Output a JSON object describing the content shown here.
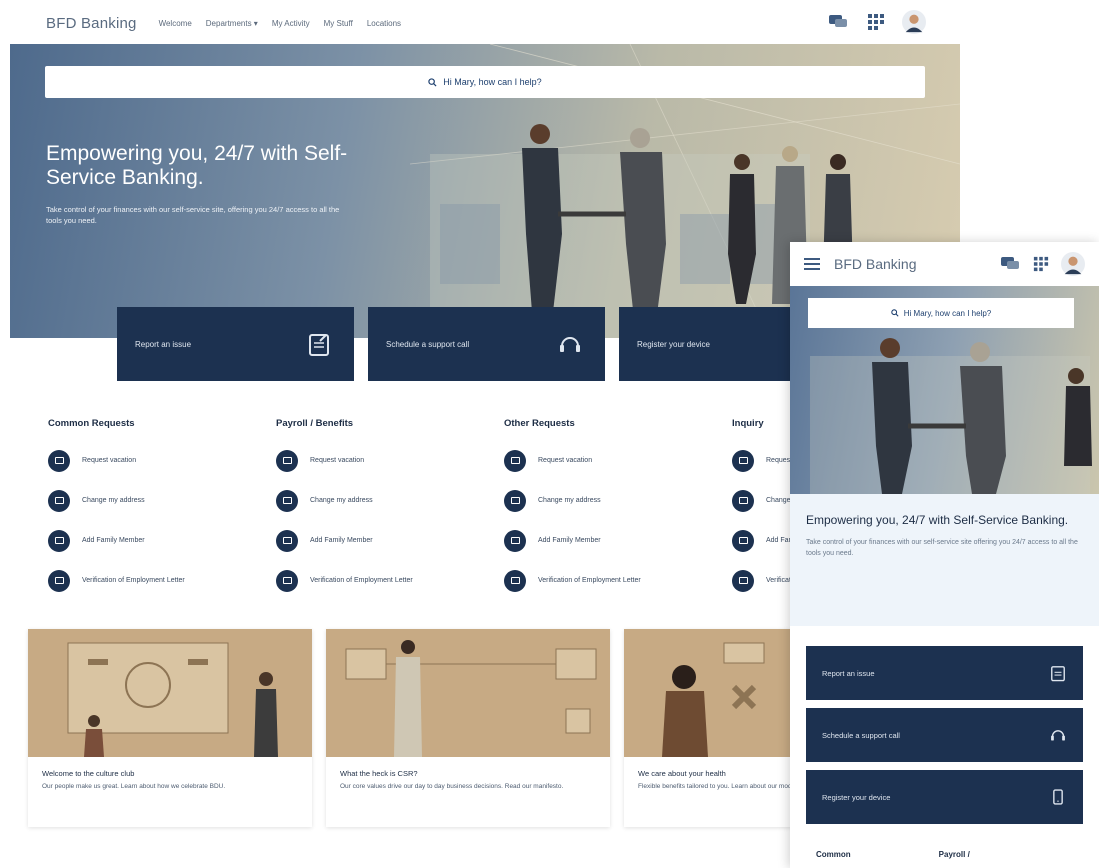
{
  "brand": "BFD Banking",
  "nav": [
    "Welcome",
    "Departments ▾",
    "My Activity",
    "My Stuff",
    "Locations"
  ],
  "search": {
    "placeholder": "Hi Mary, how can I help?"
  },
  "hero": {
    "title": "Empowering you, 24/7 with Self-Service Banking.",
    "subtitle": "Take control of your finances with our self-service site, offering you 24/7 access to all the tools you need."
  },
  "actions": [
    {
      "label": "Report an issue",
      "icon": "clipboard-icon"
    },
    {
      "label": "Schedule a support call",
      "icon": "headset-icon"
    },
    {
      "label": "Register your device",
      "icon": "phone-icon"
    }
  ],
  "request_columns": [
    {
      "title": "Common Requests",
      "items": [
        "Request vacation",
        "Change my address",
        "Add Family Member",
        "Verification of Employment Letter"
      ]
    },
    {
      "title": "Payroll / Benefits",
      "items": [
        "Request vacation",
        "Change my address",
        "Add Family Member",
        "Verification of Employment Letter"
      ]
    },
    {
      "title": "Other Requests",
      "items": [
        "Request vacation",
        "Change my address",
        "Add Family Member",
        "Verification of Employment Letter"
      ]
    },
    {
      "title": "Inquiry",
      "items": [
        "Request vacation",
        "Change my address",
        "Add Family Member",
        "Verification of Employment Letter"
      ]
    }
  ],
  "news": [
    {
      "title": "Welcome to the culture club",
      "desc": "Our people make us great. Learn about how we celebrate BDU."
    },
    {
      "title": "What the heck is CSR?",
      "desc": "Our core values drive our day to day business decisions. Read our manifesto."
    },
    {
      "title": "We care about your health",
      "desc": "Flexible benefits tailored to you. Learn about our modern plans you are."
    }
  ],
  "mobile": {
    "title": "Empowering you, 24/7 with  Self-Service Banking.",
    "subtitle": "Take control of your finances with our self-service site offering you 24/7 access to all the tools you need.",
    "categories": [
      "Common",
      "Payroll /"
    ]
  },
  "colors": {
    "navy": "#1c3150",
    "hero_start": "#4e6a8c",
    "hero_end": "#d7ccb0"
  }
}
